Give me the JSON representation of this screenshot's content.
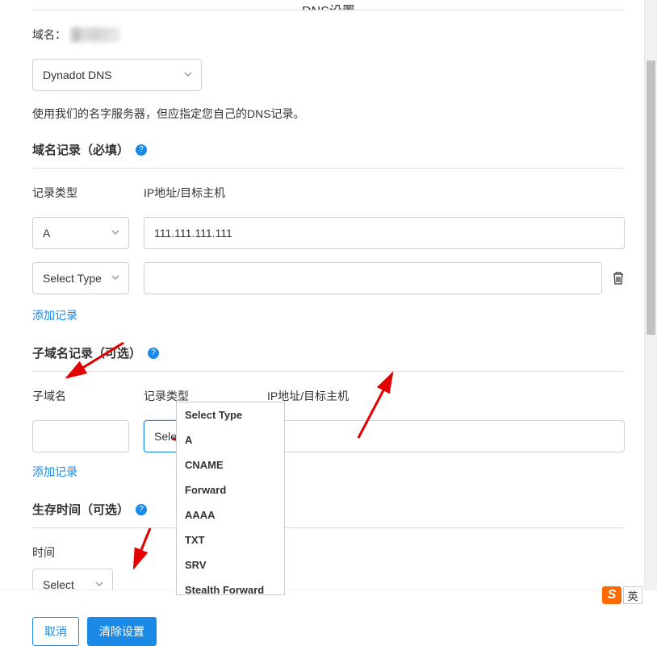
{
  "page_title": "DNS设置",
  "domain_label": "域名：",
  "dns_select": {
    "value": "Dynadot DNS"
  },
  "hint": "使用我们的名字服务器，但应指定您自己的DNS记录。",
  "section_records": {
    "title": "域名记录（必填）",
    "type_label": "记录类型",
    "ip_label": "IP地址/目标主机",
    "rows": [
      {
        "type": "A",
        "ip": "111.111.111.111"
      },
      {
        "type": "Select Type",
        "ip": ""
      }
    ],
    "add_link": "添加记录"
  },
  "section_sub": {
    "title": "子域名记录（可选）",
    "sub_label": "子域名",
    "type_label": "记录类型",
    "ip_label": "IP地址/目标主机",
    "type_value": "Select Type",
    "add_link": "添加记录",
    "dropdown_options": [
      "Select Type",
      "A",
      "CNAME",
      "Forward",
      "AAAA",
      "TXT",
      "SRV",
      "Stealth Forward"
    ]
  },
  "section_ttl": {
    "title": "生存时间（可选）",
    "time_label": "时间",
    "select_value": "Select"
  },
  "buttons": {
    "cancel": "取消",
    "clear": "清除设置"
  },
  "ime": {
    "logo": "S",
    "lang": "英"
  },
  "help_glyph": "?"
}
